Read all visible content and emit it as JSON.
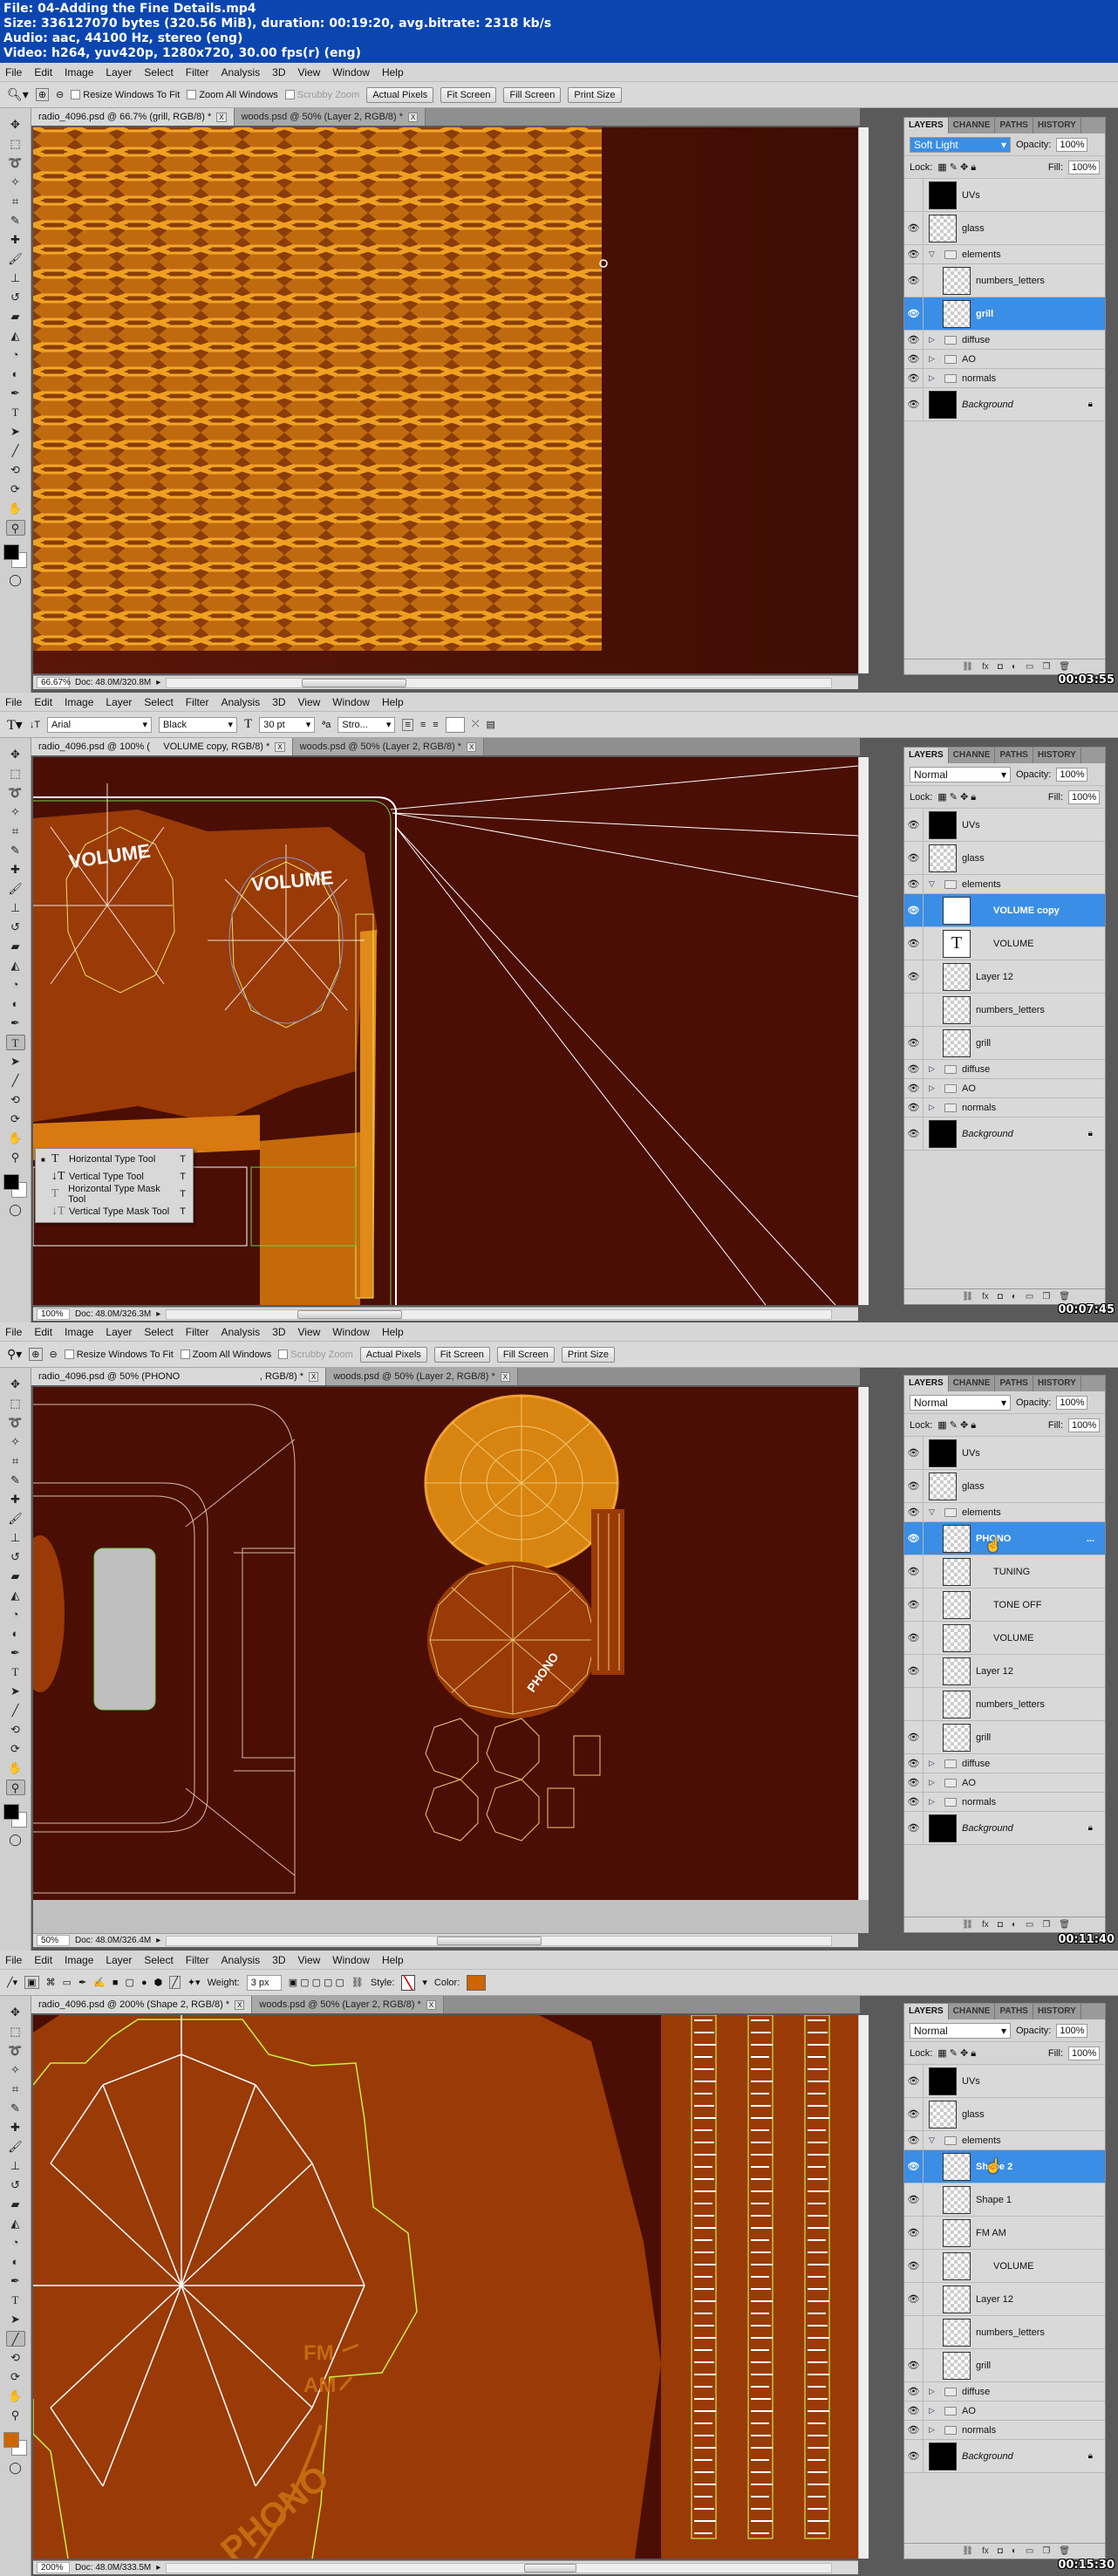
{
  "header": {
    "line1": "File: 04-Adding the Fine Details.mp4",
    "line2": "Size: 336127070 bytes (320.56 MiB), duration: 00:19:20, avg.bitrate: 2318 kb/s",
    "line3": "Audio: aac, 44100 Hz, stereo (eng)",
    "line4": "Video: h264, yuv420p, 1280x720, 30.00 fps(r) (eng)"
  },
  "menu": [
    "File",
    "Edit",
    "Image",
    "Layer",
    "Select",
    "Filter",
    "Analysis",
    "3D",
    "View",
    "Window",
    "Help"
  ],
  "panel_tabs": [
    "LAYERS",
    "CHANNE",
    "PATHS",
    "HISTORY"
  ],
  "panel_labels": {
    "opacity": "Opacity:",
    "fill": "Fill:",
    "lock": "Lock:",
    "opacity_value": "100%",
    "fill_value": "100%"
  },
  "zoom_options": {
    "resize": "Resize Windows To Fit",
    "zoom_all": "Zoom All Windows",
    "scrubby": "Scrubby Zoom",
    "actual": "Actual Pixels",
    "fit": "Fit Screen",
    "fill": "Fill Screen",
    "print": "Print Size"
  },
  "frames": [
    {
      "timestamp": "00:03:55",
      "tabs": [
        {
          "label": "radio_4096.psd @ 66.7% (grill, RGB/8) *",
          "active": true
        },
        {
          "label": "woods.psd @ 50% (Layer 2, RGB/8) *",
          "active": false
        }
      ],
      "zoom": "66.67%",
      "doc": "Doc: 48.0M/320.8M",
      "blend_mode": "Soft Light",
      "layers": [
        "UVs",
        "glass",
        "elements",
        "numbers_letters",
        "grill",
        "diffuse",
        "AO",
        "normals",
        "Background"
      ],
      "selected_layer": "grill"
    },
    {
      "timestamp": "00:07:45",
      "tabs": [
        {
          "label": "radio_4096.psd @ 100% (     VOLUME copy, RGB/8) *",
          "active": true
        },
        {
          "label": "woods.psd @ 50% (Layer 2, RGB/8) *",
          "active": false
        }
      ],
      "type_options": {
        "font": "Arial",
        "style": "Black",
        "size": "30 pt",
        "aa": "Stro..."
      },
      "zoom": "100%",
      "doc": "Doc: 48.0M/326.3M",
      "blend_mode": "Normal",
      "layers": [
        "UVs",
        "glass",
        "elements",
        "VOLUME copy",
        "VOLUME",
        "Layer 12",
        "numbers_letters",
        "grill",
        "diffuse",
        "AO",
        "normals",
        "Background"
      ],
      "selected_layer": "VOLUME copy",
      "flyout": [
        {
          "label": "Horizontal Type Tool",
          "key": "T",
          "current": true
        },
        {
          "label": "Vertical Type Tool",
          "key": "T",
          "current": false
        },
        {
          "label": "Horizontal Type Mask Tool",
          "key": "T",
          "current": false
        },
        {
          "label": "Vertical Type Mask Tool",
          "key": "T",
          "current": false
        }
      ],
      "canvas_text": [
        "VOLUME",
        "VOLUME"
      ]
    },
    {
      "timestamp": "00:11:40",
      "tabs": [
        {
          "label": "radio_4096.psd @ 50% (PHONO                              , RGB/8) *",
          "active": true
        },
        {
          "label": "woods.psd @ 50% (Layer 2, RGB/8) *",
          "active": false
        }
      ],
      "zoom": "50%",
      "doc": "Doc: 48.0M/326.4M",
      "blend_mode": "Normal",
      "layers": [
        "UVs",
        "glass",
        "elements",
        "PHONO",
        "TUNING",
        "TONE OFF",
        "VOLUME",
        "Layer 12",
        "numbers_letters",
        "grill",
        "diffuse",
        "AO",
        "normals",
        "Background"
      ],
      "selected_layer": "PHONO",
      "canvas_text": [
        "PHONO"
      ]
    },
    {
      "timestamp": "00:15:30",
      "tabs": [
        {
          "label": "radio_4096.psd @ 200% (Shape 2, RGB/8) *",
          "active": true
        },
        {
          "label": "woods.psd @ 50% (Layer 2, RGB/8) *",
          "active": false
        }
      ],
      "line_options": {
        "weight_label": "Weight:",
        "weight": "3 px",
        "style_label": "Style:",
        "color_label": "Color:",
        "color": "#cc6600"
      },
      "zoom": "200%",
      "doc": "Doc: 48.0M/333.5M",
      "blend_mode": "Normal",
      "layers": [
        "UVs",
        "glass",
        "elements",
        "Shape 2",
        "Shape 1",
        "FM AM",
        "VOLUME",
        "Layer 12",
        "numbers_letters",
        "grill",
        "diffuse",
        "AO",
        "normals",
        "Background"
      ],
      "selected_layer": "Shape 2",
      "canvas_text": [
        "FM",
        "AM",
        "PHONO"
      ]
    }
  ],
  "colors": {
    "selection": "#3a8ee6",
    "accent_orange": "#cc6600",
    "canvas_dark": "#4b0f05",
    "title_blue": "#0b46b0"
  }
}
